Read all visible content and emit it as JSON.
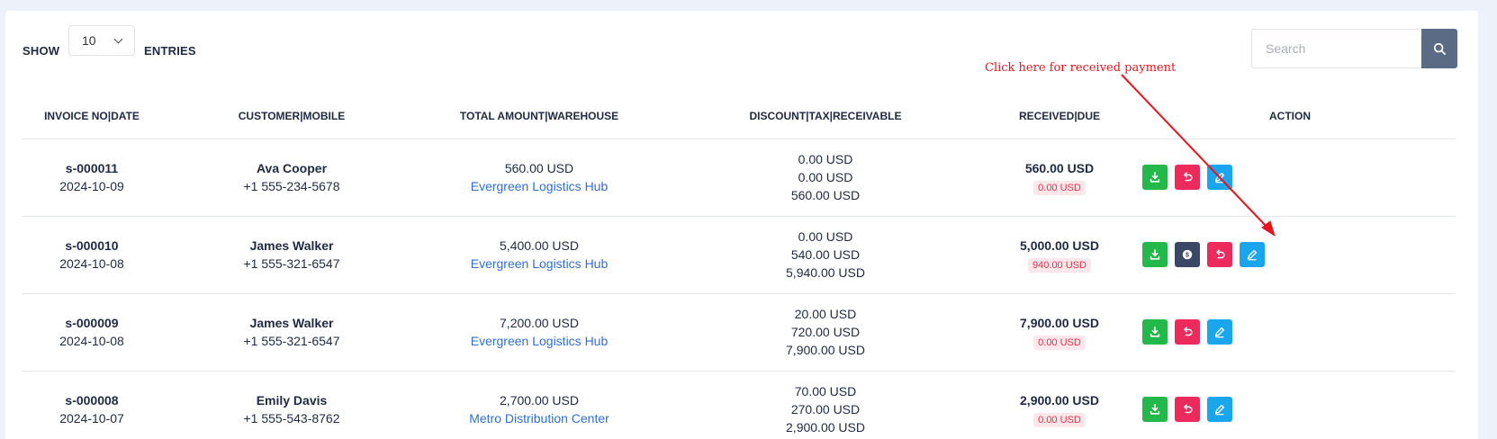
{
  "toolbar": {
    "show_label": "SHOW",
    "entries_value": "10",
    "entries_label": "ENTRIES",
    "search_placeholder": "Search"
  },
  "annotation": {
    "text": "Click here for received payment",
    "color": "#e8141c"
  },
  "table": {
    "headers": [
      "INVOICE NO|DATE",
      "CUSTOMER|MOBILE",
      "TOTAL AMOUNT|WAREHOUSE",
      "DISCOUNT|TAX|RECEIVABLE",
      "RECEIVED|DUE",
      "ACTION"
    ],
    "rows": [
      {
        "invoice": "s-000011",
        "date": "2024-10-09",
        "customer": "Ava Cooper",
        "mobile": "+1 555-234-5678",
        "total": "560.00 USD",
        "warehouse": "Evergreen Logistics Hub",
        "discount": "0.00 USD",
        "tax": "0.00 USD",
        "receivable": "560.00 USD",
        "received": "560.00 USD",
        "due": "0.00 USD",
        "has_payment_button": false
      },
      {
        "invoice": "s-000010",
        "date": "2024-10-08",
        "customer": "James Walker",
        "mobile": "+1 555-321-6547",
        "total": "5,400.00 USD",
        "warehouse": "Evergreen Logistics Hub",
        "discount": "0.00 USD",
        "tax": "540.00 USD",
        "receivable": "5,940.00 USD",
        "received": "5,000.00 USD",
        "due": "940.00 USD",
        "has_payment_button": true
      },
      {
        "invoice": "s-000009",
        "date": "2024-10-08",
        "customer": "James Walker",
        "mobile": "+1 555-321-6547",
        "total": "7,200.00 USD",
        "warehouse": "Evergreen Logistics Hub",
        "discount": "20.00 USD",
        "tax": "720.00 USD",
        "receivable": "7,900.00 USD",
        "received": "7,900.00 USD",
        "due": "0.00 USD",
        "has_payment_button": false
      },
      {
        "invoice": "s-000008",
        "date": "2024-10-07",
        "customer": "Emily Davis",
        "mobile": "+1 555-543-8762",
        "total": "2,700.00 USD",
        "warehouse": "Metro Distribution Center",
        "discount": "70.00 USD",
        "tax": "270.00 USD",
        "receivable": "2,900.00 USD",
        "received": "2,900.00 USD",
        "due": "0.00 USD",
        "has_payment_button": false
      }
    ]
  },
  "icons": {
    "download": "download-icon",
    "payment": "dollar-coin-icon",
    "return": "undo-icon",
    "edit": "pencil-icon",
    "search": "search-icon"
  },
  "colors": {
    "download_button": "#23b84a",
    "return_button": "#ed2a5c",
    "edit_button": "#1aa6ef",
    "payment_button": "#3b4766",
    "link": "#2f6fd6",
    "due_badge_text": "#e3304b"
  }
}
